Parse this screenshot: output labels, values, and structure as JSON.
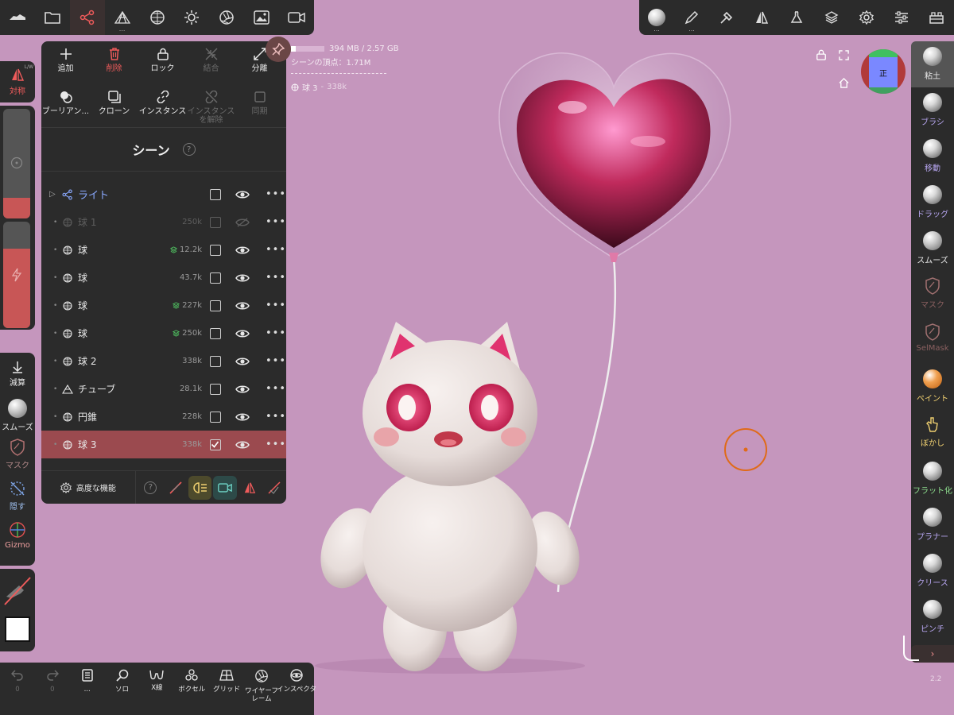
{
  "memory": "394 MB / 2.57 GB",
  "scene_vertices": "シーンの頂点：1.71M",
  "selected_info": {
    "name": "球 3",
    "count": "338k"
  },
  "scene_actions": [
    {
      "label": "追加",
      "state": "normal"
    },
    {
      "label": "削除",
      "state": "red"
    },
    {
      "label": "ロック",
      "state": "normal"
    },
    {
      "label": "結合",
      "state": "dim"
    },
    {
      "label": "分離",
      "state": "normal"
    },
    {
      "label": "ブーリアン...",
      "state": "normal"
    },
    {
      "label": "クローン",
      "state": "normal"
    },
    {
      "label": "インスタンス",
      "state": "normal"
    },
    {
      "label": "インスタンスを解除",
      "state": "dim"
    },
    {
      "label": "同期",
      "state": "dim"
    }
  ],
  "scene_title": "シーン",
  "scene_help": "?",
  "layers": [
    {
      "name": "ライト",
      "count": "",
      "checked": false,
      "visible": true,
      "icon": "light-node-icon",
      "type": "light"
    },
    {
      "name": "球 1",
      "count": "250k",
      "checked": false,
      "visible": false,
      "icon": "sphere-icon",
      "type": "hidden"
    },
    {
      "name": "球",
      "count": "12.2k",
      "checked": false,
      "visible": true,
      "icon": "sphere-icon",
      "multires": true
    },
    {
      "name": "球",
      "count": "43.7k",
      "checked": false,
      "visible": true,
      "icon": "sphere-icon"
    },
    {
      "name": "球",
      "count": "227k",
      "checked": false,
      "visible": true,
      "icon": "sphere-icon",
      "multires": true
    },
    {
      "name": "球",
      "count": "250k",
      "checked": false,
      "visible": true,
      "icon": "sphere-icon",
      "multires": true
    },
    {
      "name": "球 2",
      "count": "338k",
      "checked": false,
      "visible": true,
      "icon": "sphere-icon"
    },
    {
      "name": "チューブ",
      "count": "28.1k",
      "checked": false,
      "visible": true,
      "icon": "tube-icon"
    },
    {
      "name": "円錐",
      "count": "228k",
      "checked": false,
      "visible": true,
      "icon": "sphere-icon"
    },
    {
      "name": "球 3",
      "count": "338k",
      "checked": true,
      "visible": true,
      "icon": "sphere-icon",
      "selected": true
    }
  ],
  "advanced_label": "高度な機能",
  "left_tools": {
    "symmetry": "対称",
    "symmetry_mode": "L/W",
    "subtract": "減算",
    "smooth": "スムーズ",
    "mask": "マスク",
    "hide": "隠す",
    "gizmo": "Gizmo"
  },
  "right_tools": [
    {
      "label": "粘土",
      "color": "#e8e8e8",
      "active": true
    },
    {
      "label": "ブラシ",
      "color": "#b7a6f0"
    },
    {
      "label": "移動",
      "color": "#b7a6f0"
    },
    {
      "label": "ドラッグ",
      "color": "#b7a6f0"
    },
    {
      "label": "スムーズ",
      "color": "#e8e8e8"
    },
    {
      "label": "マスク",
      "color": "#8a6060"
    },
    {
      "label": "SelMask",
      "color": "#8a6060"
    },
    {
      "label": "ペイント",
      "color": "#f0d070"
    },
    {
      "label": "ぼかし",
      "color": "#f0d070"
    },
    {
      "label": "フラット化",
      "color": "#8fe08f"
    },
    {
      "label": "プラナー",
      "color": "#b7a6f0"
    },
    {
      "label": "クリース",
      "color": "#b7a6f0"
    },
    {
      "label": "ピンチ",
      "color": "#b7a6f0"
    }
  ],
  "bottom_tools": [
    {
      "label": "0",
      "icon": "undo-icon",
      "dim": true
    },
    {
      "label": "0",
      "icon": "redo-icon",
      "dim": true
    },
    {
      "label": "...",
      "icon": "notebook-icon"
    },
    {
      "label": "ソロ",
      "icon": "search-icon"
    },
    {
      "label": "X線",
      "icon": "xray-glasses-icon"
    },
    {
      "label": "ボクセル",
      "icon": "voxel-icon"
    },
    {
      "label": "グリッド",
      "icon": "grid-icon"
    },
    {
      "label": "ワイヤーフレーム",
      "icon": "wireframe-icon"
    },
    {
      "label": "インスペクタ",
      "icon": "inspector-icon"
    }
  ],
  "view_cube_label": "正",
  "version": "2.2",
  "colors": {
    "background": "#c596bd",
    "panel": "#2b2b2b",
    "accent_red": "#ef5b5b",
    "selected_row": "#9b4a4f",
    "light_blue": "#8aa9ff"
  }
}
